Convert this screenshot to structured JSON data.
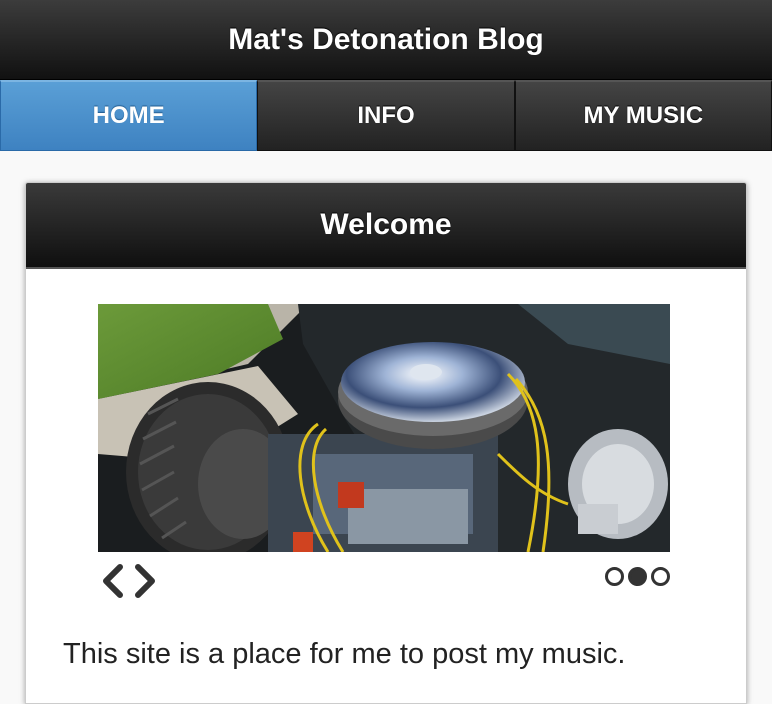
{
  "header": {
    "title": "Mat's Detonation Blog"
  },
  "nav": {
    "tabs": [
      {
        "label": "HOME",
        "active": true
      },
      {
        "label": "INFO",
        "active": false
      },
      {
        "label": "MY MUSIC",
        "active": false
      }
    ]
  },
  "panel": {
    "title": "Welcome",
    "slider": {
      "image": "car-engine-photo",
      "prev_icon": "chevron-left-icon",
      "next_icon": "chevron-right-icon",
      "slide_count": 3,
      "active_slide": 2
    },
    "intro": "This site is a place for me to post my music."
  },
  "colors": {
    "active_tab": "#4a90cc",
    "header_bg": "#1c1c1c"
  }
}
